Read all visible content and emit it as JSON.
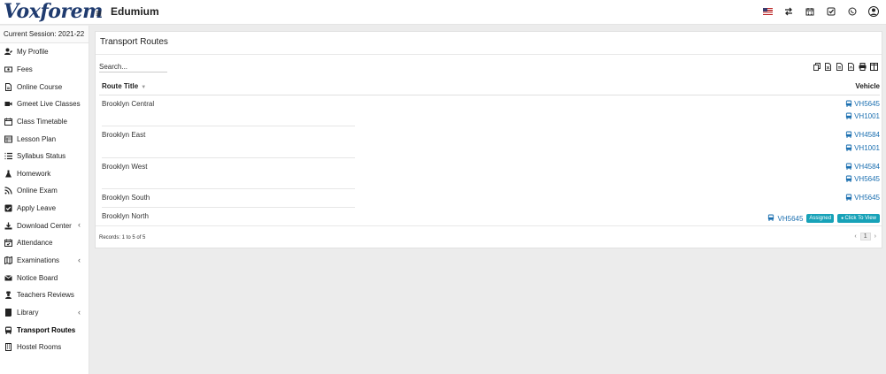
{
  "header": {
    "logo_text": "Voxforem",
    "app_title": "Edumium",
    "icons": [
      "us-flag-icon",
      "exchange-icon",
      "calendar-icon",
      "checkbox-icon",
      "whatsapp-icon",
      "user-avatar-icon"
    ]
  },
  "sidebar": {
    "session": "Current Session: 2021-22",
    "items": [
      {
        "label": "My Profile",
        "icon": "user-edit-icon",
        "has_submenu": false
      },
      {
        "label": "Fees",
        "icon": "money-icon",
        "has_submenu": false
      },
      {
        "label": "Online Course",
        "icon": "file-icon",
        "has_submenu": false
      },
      {
        "label": "Gmeet Live Classes",
        "icon": "video-icon",
        "has_submenu": false
      },
      {
        "label": "Class Timetable",
        "icon": "calendar-icon",
        "has_submenu": false
      },
      {
        "label": "Lesson Plan",
        "icon": "table-icon",
        "has_submenu": false
      },
      {
        "label": "Syllabus Status",
        "icon": "list-icon",
        "has_submenu": false
      },
      {
        "label": "Homework",
        "icon": "flask-icon",
        "has_submenu": false
      },
      {
        "label": "Online Exam",
        "icon": "rss-icon",
        "has_submenu": false
      },
      {
        "label": "Apply Leave",
        "icon": "check-square-icon",
        "has_submenu": false
      },
      {
        "label": "Download Center",
        "icon": "download-icon",
        "has_submenu": true
      },
      {
        "label": "Attendance",
        "icon": "calendar-check-icon",
        "has_submenu": false
      },
      {
        "label": "Examinations",
        "icon": "map-icon",
        "has_submenu": true
      },
      {
        "label": "Notice Board",
        "icon": "envelope-icon",
        "has_submenu": false
      },
      {
        "label": "Teachers Reviews",
        "icon": "user-secret-icon",
        "has_submenu": false
      },
      {
        "label": "Library",
        "icon": "book-icon",
        "has_submenu": true
      },
      {
        "label": "Transport Routes",
        "icon": "bus-icon",
        "has_submenu": false,
        "active": true
      },
      {
        "label": "Hostel Rooms",
        "icon": "building-icon",
        "has_submenu": false
      }
    ]
  },
  "main": {
    "title": "Transport Routes",
    "search_placeholder": "Search...",
    "tools": [
      "copy-icon",
      "excel-icon",
      "csv-icon",
      "pdf-icon",
      "print-icon",
      "columns-icon"
    ],
    "columns": [
      "Route Title",
      "Vehicle"
    ],
    "rows": [
      {
        "route": "Brooklyn Central",
        "vehicles": [
          "VH5645",
          "VH1001"
        ]
      },
      {
        "route": "Brooklyn East",
        "vehicles": [
          "VH4584",
          "VH1001"
        ]
      },
      {
        "route": "Brooklyn West",
        "vehicles": [
          "VH4584",
          "VH5645"
        ]
      },
      {
        "route": "Brooklyn South",
        "vehicles": [
          "VH5645"
        ]
      },
      {
        "route": "Brooklyn North",
        "vehicles": [
          "VH5645"
        ],
        "assigned_label": "Assigned",
        "view_label": "Click To View"
      }
    ],
    "records_text": "Records: 1 to 5 of 5",
    "pager": {
      "prev": "‹",
      "page": "1",
      "next": "›"
    }
  },
  "colors": {
    "link": "#1b6fb0",
    "badge": "#17a2b8",
    "logo": "#1f3b6f"
  }
}
